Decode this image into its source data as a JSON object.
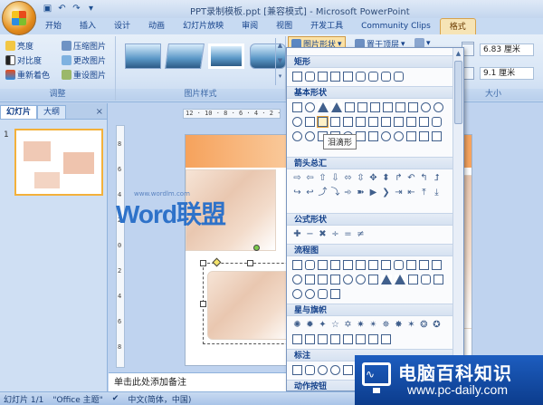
{
  "window": {
    "title": "PPT录制模板.ppt [兼容模式] - Microsoft PowerPoint"
  },
  "quick_access": [
    {
      "icon": "save-icon",
      "glyph": "▣"
    },
    {
      "icon": "undo-icon",
      "glyph": "↶"
    },
    {
      "icon": "redo-icon",
      "glyph": "↷"
    },
    {
      "icon": "customize-icon",
      "glyph": "▾"
    }
  ],
  "ribbon_tabs": [
    "开始",
    "插入",
    "设计",
    "动画",
    "幻灯片放映",
    "审阅",
    "视图",
    "开发工具",
    "Community Clips",
    "格式"
  ],
  "ribbon_active_tab": "格式",
  "adjust_group": {
    "label": "调整",
    "buttons": [
      "亮度",
      "对比度",
      "重新着色",
      "压缩图片",
      "更改图片",
      "重设图片"
    ]
  },
  "picture_styles_group": {
    "label": "图片样式"
  },
  "arrange_group": {
    "shape_button": "图片形状",
    "bring_front": "置于顶层"
  },
  "size_group": {
    "label": "大小",
    "height": "6.83 厘米",
    "width": "9.1 厘米"
  },
  "left_pane": {
    "tabs": [
      "幻灯片",
      "大纲"
    ],
    "close": "×",
    "slide_number": "1"
  },
  "shapes_menu": {
    "sections": [
      "矩形",
      "基本形状",
      "箭头总汇",
      "公式形状",
      "流程图",
      "星与旗帜",
      "标注",
      "动作按钮"
    ],
    "tooltip": "泪滴形"
  },
  "rulers": {
    "horizontal": "12 · 10 · 8 · 6 · 4 · 2 · 0",
    "vertical": [
      "8",
      "6",
      "4",
      "2",
      "0",
      "2",
      "4",
      "6",
      "8"
    ]
  },
  "watermark": {
    "text": "Word联盟",
    "url": "www.wordlm.com"
  },
  "notes_placeholder": "单击此处添加备注",
  "status": {
    "slide": "幻灯片 1/1",
    "theme": "\"Office 主题\"",
    "language": "中文(简体，中国)"
  },
  "site_logo": {
    "name": "电脑百科知识",
    "url": "www.pc-daily.com"
  }
}
